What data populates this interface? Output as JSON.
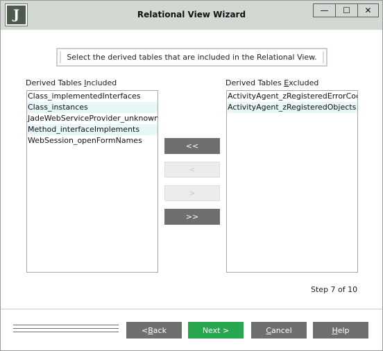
{
  "window": {
    "title": "Relational View Wizard",
    "app_icon_letter": "J",
    "controls": {
      "minimize": "—",
      "maximize": "☐",
      "close": "✕"
    }
  },
  "instruction": "Select the derived tables that are included in the Relational View.",
  "included": {
    "label_before": "Derived Tables ",
    "label_mnemonic": "I",
    "label_after": "ncluded",
    "items": [
      "Class_implementedInterfaces",
      "Class_instances",
      "JadeWebServiceProvider_unknownHea",
      "Method_interfaceImplements",
      "WebSession_openFormNames"
    ]
  },
  "excluded": {
    "label_before": "Derived Tables ",
    "label_mnemonic": "E",
    "label_after": "xcluded",
    "items": [
      "ActivityAgent_zRegisteredErrorCodes",
      "ActivityAgent_zRegisteredObjects"
    ]
  },
  "move_buttons": {
    "include_all": "<<",
    "include_one": "<",
    "exclude_one": ">",
    "exclude_all": ">>"
  },
  "step_text": "Step 7 of 10",
  "footer": {
    "back_prefix": "< ",
    "back_mnemonic": "B",
    "back_rest": "ack",
    "next": "Next >",
    "cancel_mnemonic": "C",
    "cancel_rest": "ancel",
    "help_mnemonic": "H",
    "help_rest": "elp"
  },
  "colors": {
    "titlebar": "#d2d9d2",
    "button_gray": "#6e706e",
    "button_next_green": "#27a84e",
    "list_alt_row": "#e7f7f7"
  }
}
